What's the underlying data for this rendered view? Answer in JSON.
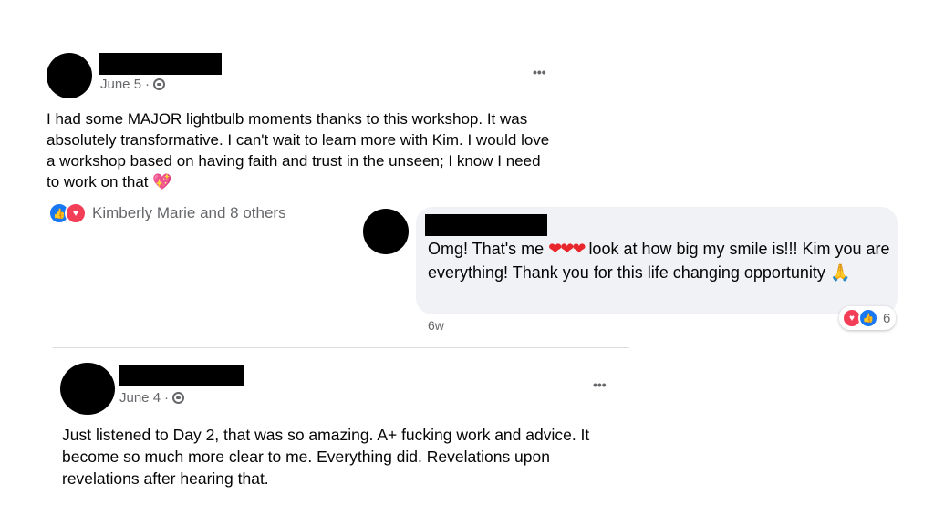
{
  "post1": {
    "date": "June 5",
    "separator": "·",
    "more_label": "•••",
    "text": "I had some MAJOR lightbulb moments thanks to this workshop. It was absolutely transformative. I can't wait to learn more with Kim. I would love a workshop based on having faith and trust in the unseen; I know I need to work on that",
    "emoji": "💖",
    "reactions_label": "Kimberly Marie and 8 others",
    "privacy_icon": "globe-icon"
  },
  "comment": {
    "text_before": "Omg! That's me",
    "hearts": "❤❤❤",
    "text_after": "look at how big my smile is!!! Kim you are everything! Thank you for this life changing opportunity",
    "emoji": "🙏",
    "time": "6w",
    "reaction_count": "6"
  },
  "post2": {
    "date": "June 4",
    "separator": "·",
    "more_label": "•••",
    "text": "Just listened to Day 2, that was so amazing. A+ fucking work and advice. It become so much more clear to me. Everything did. Revelations upon revelations after hearing that.",
    "privacy_icon": "globe-icon"
  },
  "colors": {
    "like_blue": "#1877f2",
    "love_red": "#f33e58",
    "bubble_bg": "#f0f2f5",
    "meta_gray": "#65676b"
  }
}
